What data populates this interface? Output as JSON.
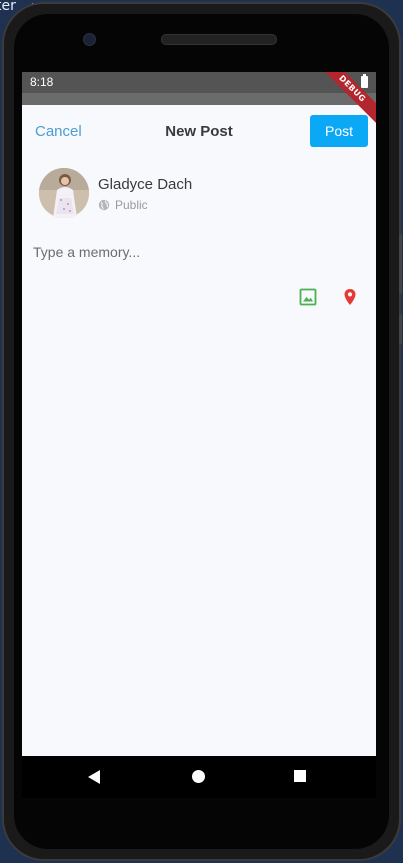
{
  "backdrop": {
    "text": "ter"
  },
  "status_bar": {
    "time": "8:18",
    "debug_label": "DEBUG"
  },
  "header": {
    "cancel_label": "Cancel",
    "title": "New Post",
    "post_label": "Post"
  },
  "user": {
    "name": "Gladyce Dach",
    "visibility": "Public"
  },
  "composer": {
    "placeholder": "Type a memory...",
    "value": ""
  },
  "actions": [
    {
      "icon": "image-icon",
      "color": "#4caf50"
    },
    {
      "icon": "location-pin-icon",
      "color": "#e53935"
    }
  ],
  "colors": {
    "accent": "#0ba8f5",
    "link": "#4a9fd0",
    "background": "#f7f9fd"
  }
}
